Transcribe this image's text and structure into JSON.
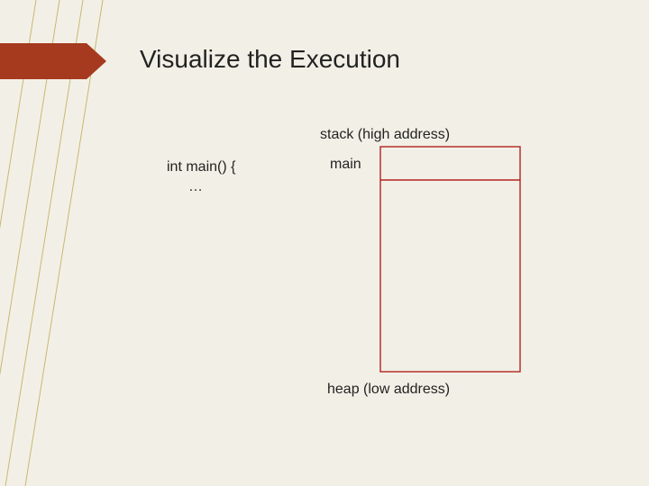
{
  "title": "Visualize the Execution",
  "code": {
    "line1": "int main() {",
    "line2": "…"
  },
  "stack": {
    "top_label": "stack (high address)",
    "bottom_label": "heap (low address)",
    "frame_label": "main"
  },
  "colors": {
    "background": "#f2f0e6",
    "deco_line": "#c9b870",
    "arrow": "#a63a1f",
    "stack_border": "#b22222"
  }
}
